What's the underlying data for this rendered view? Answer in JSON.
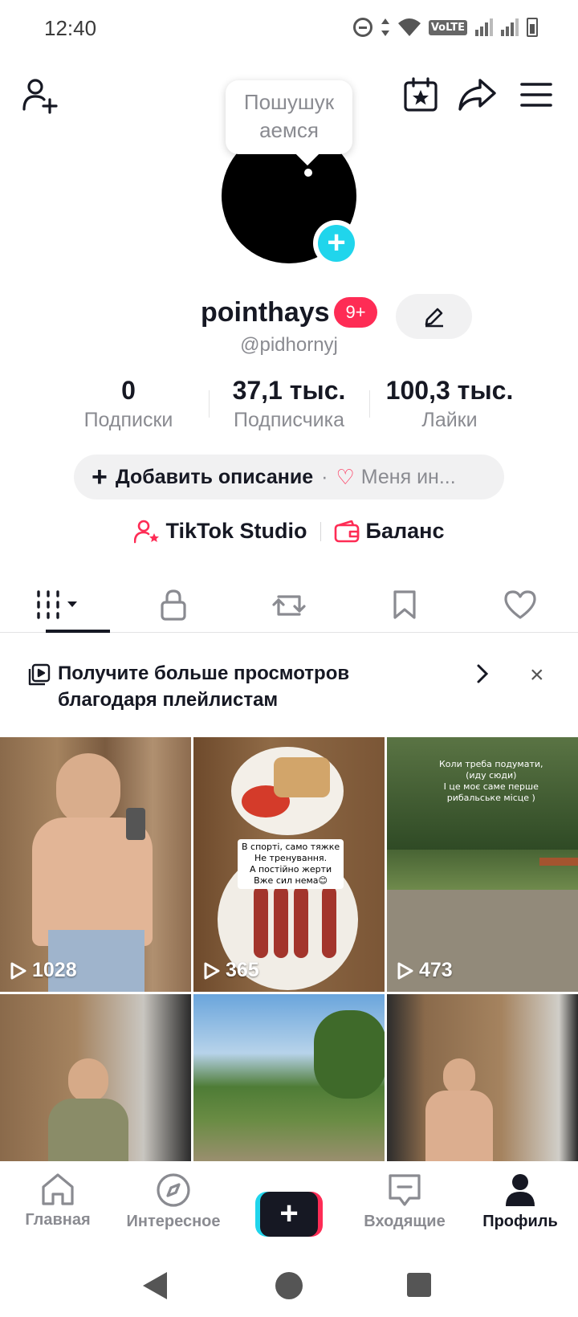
{
  "status_bar": {
    "time": "12:40",
    "network": "VoLTE"
  },
  "header": {
    "tooltip_line1": "Пошушук",
    "tooltip_line2": "аемся"
  },
  "profile": {
    "display_name": "pointhays",
    "notification_badge": "9+",
    "handle": "@pidhornyj"
  },
  "stats": [
    {
      "value": "0",
      "label": "Подписки"
    },
    {
      "value": "37,1 тыс.",
      "label": "Подписчика"
    },
    {
      "value": "100,3 тыс.",
      "label": "Лайки"
    }
  ],
  "bio": {
    "add_label": "Добавить описание",
    "separator": "·",
    "interest_label": "Меня ин..."
  },
  "links": {
    "studio": "TikTok Studio",
    "balance": "Баланс"
  },
  "promo": {
    "text_line1": "Получите больше просмотров",
    "text_line2": "благодаря плейлистам",
    "close": "×"
  },
  "videos": [
    {
      "views": "1028",
      "overlay": ""
    },
    {
      "views": "365",
      "overlay": "В спорті, само тяжке\nНе тренування.\nА постійно жерти\nВже сил нема😊"
    },
    {
      "views": "473",
      "overlay": "Коли треба подумати,\n(иду сюди)\nІ це моє саме перше\nрибальське місце )"
    },
    {
      "views": "",
      "overlay": ""
    },
    {
      "views": "",
      "overlay": ""
    },
    {
      "views": "",
      "overlay": ""
    }
  ],
  "bottom_nav": [
    {
      "label": "Главная"
    },
    {
      "label": "Интересное"
    },
    {
      "label": ""
    },
    {
      "label": "Входящие"
    },
    {
      "label": "Профиль"
    }
  ],
  "colors": {
    "accent_red": "#fe2c55",
    "accent_cyan": "#20d5ec",
    "text_primary": "#161823",
    "text_secondary": "#8a8b91"
  }
}
